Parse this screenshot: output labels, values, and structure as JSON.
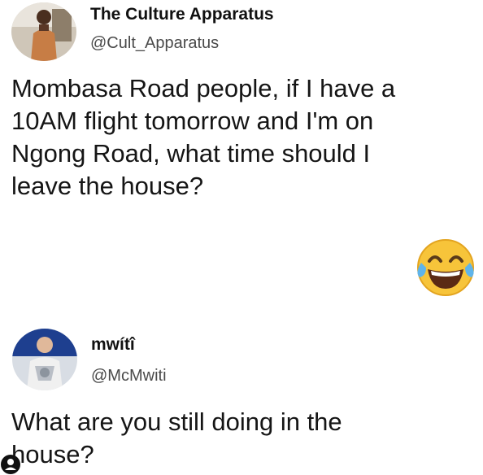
{
  "tweet": {
    "author_name": "The Culture Apparatus",
    "author_handle": "@Cult_Apparatus",
    "lines": [
      "Mombasa Road people, if I have a",
      "10AM flight tomorrow and I'm on",
      "Ngong Road, what time should I",
      "leave the house?"
    ],
    "emoji": "face-with-tears-of-joy-icon"
  },
  "reply": {
    "author_name": "mwítî",
    "author_handle": "@McMwiti",
    "lines": [
      "What are you still doing in the",
      "house?"
    ]
  },
  "colors": {
    "text": "#151515",
    "handle": "#4a4a4a",
    "emoji_yellow": "#f7c43a",
    "emoji_tear": "#5fb4ea",
    "background": "#ffffff"
  }
}
